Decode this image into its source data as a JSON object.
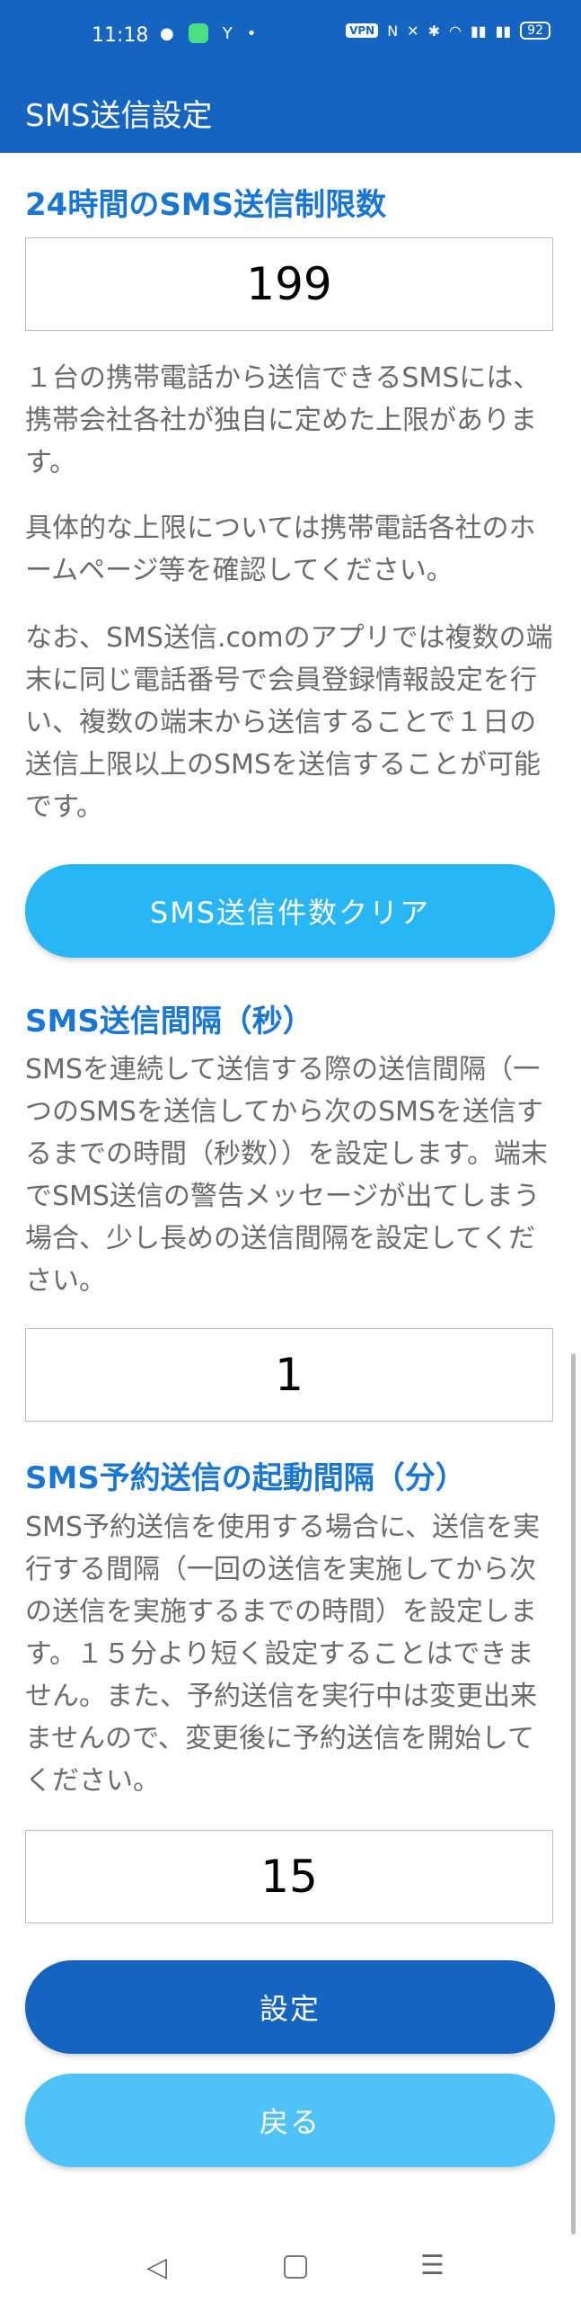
{
  "status": {
    "time": "11:18",
    "vpn": "VPN",
    "battery": "92"
  },
  "appbar": {
    "title": "SMS送信設定"
  },
  "daily": {
    "heading": "24時間のSMS送信制限数",
    "value": "199",
    "p1": "１台の携帯電話から送信できるSMSには、携帯会社各社が独自に定めた上限があります。",
    "p2": "具体的な上限については携帯電話各社のホームページ等を確認してください。",
    "p3": "なお、SMS送信.comのアプリでは複数の端末に同じ電話番号で会員登録情報設定を行い、複数の端末から送信することで１日の送信上限以上のSMSを送信することが可能です。",
    "clear_button": "SMS送信件数クリア"
  },
  "interval": {
    "heading": "SMS送信間隔（秒）",
    "desc": "SMSを連続して送信する際の送信間隔（一つのSMSを送信してから次のSMSを送信するまでの時間（秒数））を設定します。端末でSMS送信の警告メッセージが出てしまう場合、少し長めの送信間隔を設定してください。",
    "value": "1"
  },
  "scheduled": {
    "heading": "SMS予約送信の起動間隔（分）",
    "desc": "SMS予約送信を使用する場合に、送信を実行する間隔（一回の送信を実施してから次の送信を実施するまでの時間）を設定します。１５分より短く設定することはできません。また、予約送信を実行中は変更出来ませんので、変更後に予約送信を開始してください。",
    "value": "15"
  },
  "buttons": {
    "save": "設定",
    "back": "戻る"
  },
  "colors": {
    "appbar": "#1565c0",
    "heading": "#1976d2",
    "clear_button": "#29b6f6",
    "save_button": "#1565c0",
    "back_button": "#4fc3f7"
  }
}
